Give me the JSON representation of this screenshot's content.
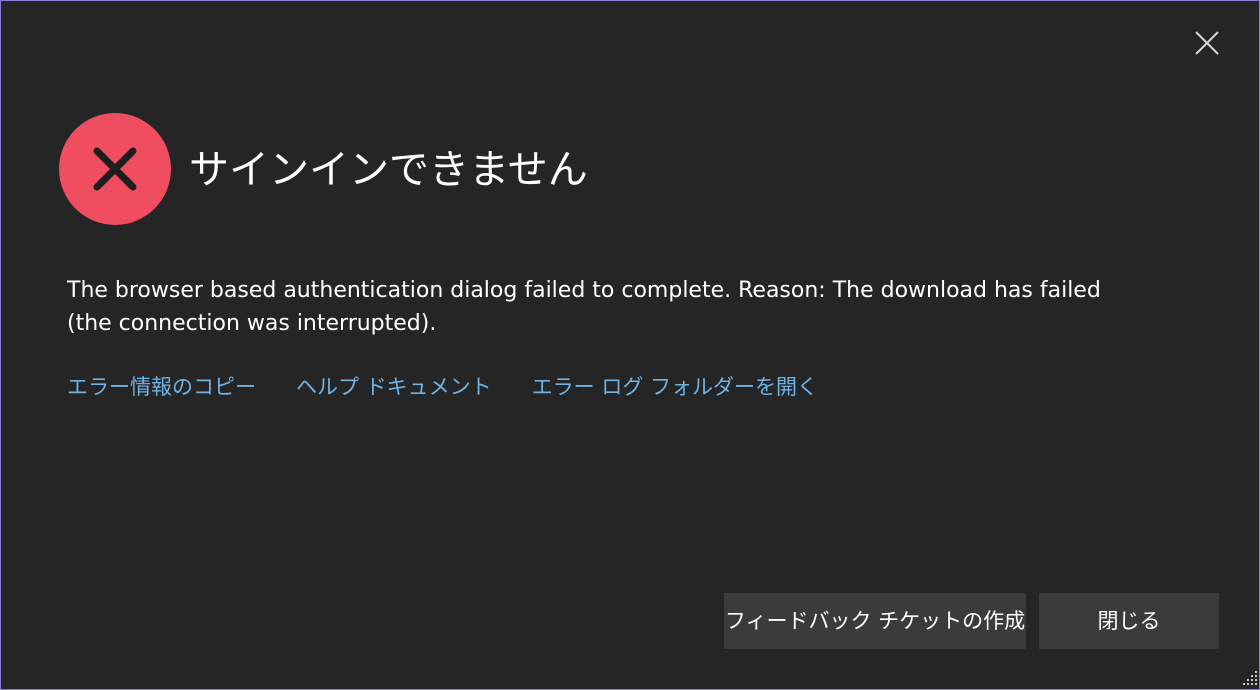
{
  "dialog": {
    "title": "サインインできません",
    "message": "The browser based authentication dialog failed to complete. Reason: The download has failed (the connection was interrupted).",
    "icons": {
      "status": "error-x-icon",
      "close": "close-icon",
      "resize": "resize-grip-icon"
    },
    "links": {
      "copy_error": "エラー情報のコピー",
      "help_docs": "ヘルプ ドキュメント",
      "open_log_folder": "エラー ログ フォルダーを開く"
    },
    "buttons": {
      "feedback": "フィードバック チケットの作成",
      "close": "閉じる"
    },
    "colors": {
      "background": "#252526",
      "border": "#8a7bd6",
      "error": "#f04d60",
      "link": "#6fb2e6",
      "button": "#3b3b3c"
    }
  }
}
